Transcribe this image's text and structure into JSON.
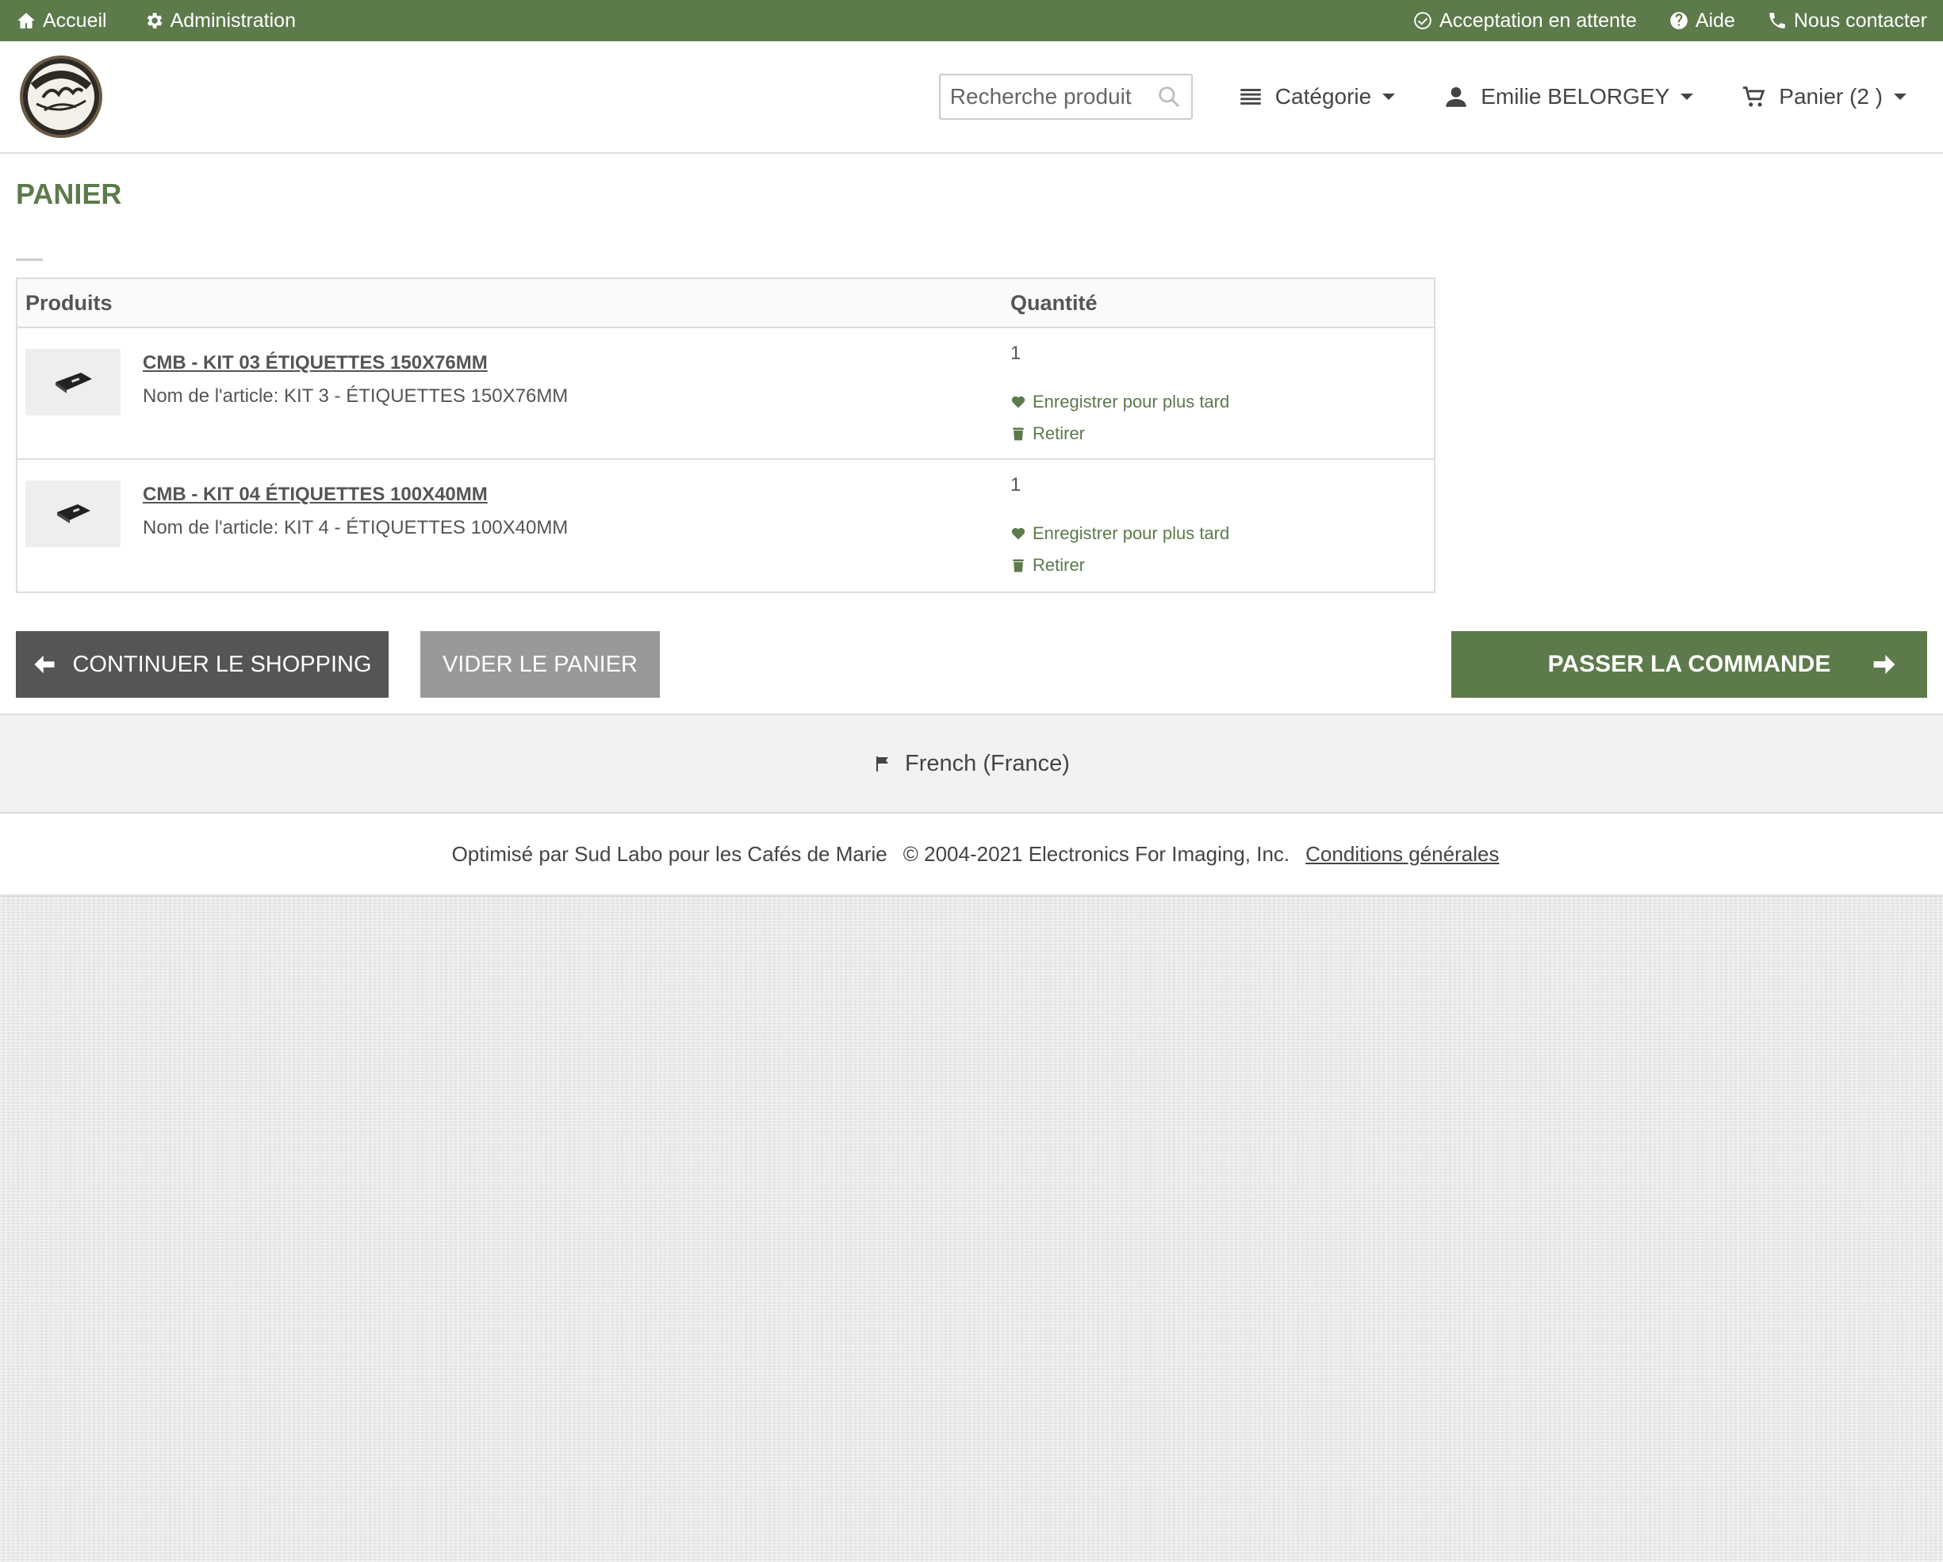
{
  "topbar": {
    "home": "Accueil",
    "admin": "Administration",
    "pending": "Acceptation en attente",
    "help": "Aide",
    "contact": "Nous contacter"
  },
  "header": {
    "search_placeholder": "Recherche produit",
    "category": "Catégorie",
    "user": "Emilie BELORGEY",
    "cart": "Panier  (2 )"
  },
  "page": {
    "title": "PANIER"
  },
  "table": {
    "col_products": "Produits",
    "col_quantity": "Quantité",
    "rows": [
      {
        "name": "CMB - KIT 03 ÉTIQUETTES 150X76MM",
        "attr": "Nom de l'article: KIT 3 - ÉTIQUETTES 150X76MM",
        "qty": "1",
        "save": "Enregistrer pour plus tard",
        "remove": "Retirer"
      },
      {
        "name": "CMB - KIT 04 ÉTIQUETTES 100X40MM",
        "attr": "Nom de l'article: KIT 4 - ÉTIQUETTES 100X40MM",
        "qty": "1",
        "save": "Enregistrer pour plus tard",
        "remove": "Retirer"
      }
    ]
  },
  "buttons": {
    "continue": "CONTINUER LE SHOPPING",
    "empty": "VIDER LE PANIER",
    "order": "PASSER LA COMMANDE"
  },
  "footer": {
    "language": "French (France)",
    "powered": "Optimisé par Sud Labo pour les Cafés de Marie",
    "copyright": "© 2004-2021 Electronics For Imaging, Inc.",
    "terms": "Conditions générales"
  },
  "colors": {
    "brand": "#5c7a4a",
    "dark_button": "#555555",
    "grey_button": "#999999"
  },
  "icons": [
    "home-icon",
    "gear-icon",
    "check-circle-icon",
    "help-icon",
    "phone-icon",
    "search-icon",
    "list-icon",
    "user-icon",
    "cart-icon",
    "heart-icon",
    "trash-icon",
    "arrow-left-icon",
    "arrow-right-icon",
    "flag-icon"
  ]
}
